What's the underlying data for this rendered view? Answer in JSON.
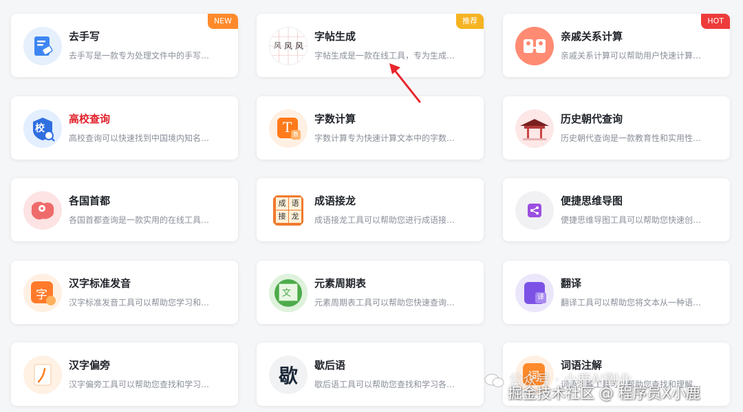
{
  "tools": [
    {
      "title": "去手写",
      "desc": "去手写是一款专为处理文件中的手写…",
      "badge": "NEW",
      "icon": "document-eraser-icon"
    },
    {
      "title": "字帖生成",
      "desc": "字帖生成是一款在线工具，专为生成…",
      "badge": "推荐",
      "icon": "calligraphy-grid-icon",
      "icon_text": [
        "风",
        "风",
        "风"
      ]
    },
    {
      "title": "亲戚关系计算",
      "desc": "亲戚关系计算可以帮助用户快速计算…",
      "badge": "HOT",
      "icon": "family-relation-icon"
    },
    {
      "title": "高校查询",
      "desc": "高校查询可以快速找到中国境内知名…",
      "icon": "school-search-icon",
      "icon_text": "校"
    },
    {
      "title": "字数计算",
      "desc": "字数计算专为快速计算文本中的字数…",
      "icon": "word-count-icon",
      "icon_text": "T",
      "icon_sub": "数"
    },
    {
      "title": "历史朝代查询",
      "desc": "历史朝代查询是一款教育性和实用性…",
      "icon": "ancient-building-icon"
    },
    {
      "title": "各国首都",
      "desc": "各国首都查询是一款实用的在线工具…",
      "icon": "world-map-pin-icon"
    },
    {
      "title": "成语接龙",
      "desc": "成语接龙工具可以帮助您进行成语接…",
      "icon": "idiom-tiles-icon",
      "icon_text": [
        "成",
        "语",
        "接",
        "龙"
      ]
    },
    {
      "title": "便捷思维导图",
      "desc": "便捷思维导图工具可以帮助您快速创…",
      "icon": "mindmap-icon"
    },
    {
      "title": "汉字标准发音",
      "desc": "汉字标准发音工具可以帮助您学习和…",
      "icon": "pronunciation-icon",
      "icon_text": "字"
    },
    {
      "title": "元素周期表",
      "desc": "元素周期表工具可以帮助您快速查询…",
      "icon": "periodic-table-icon",
      "icon_text": "文"
    },
    {
      "title": "翻译",
      "desc": "翻译工具可以帮助您将文本从一种语…",
      "icon": "translate-icon",
      "icon_text": "译"
    },
    {
      "title": "汉字偏旁",
      "desc": "汉字偏旁工具可以帮助您查找和学习…",
      "icon": "radical-stroke-icon"
    },
    {
      "title": "歇后语",
      "desc": "歇后语工具可以帮助您查找和学习各…",
      "icon": "xiehouyu-icon",
      "icon_text": "歇"
    },
    {
      "title": "词语注解",
      "desc": "词语注解工具可以帮助您查找和理解…",
      "icon": "word-annotation-icon",
      "icon_text": "词"
    }
  ],
  "watermark": {
    "line1": "公众号 · 小鹿AI副业",
    "line2": "掘金技术社区 @ 程序员X小鹿"
  },
  "colors": {
    "new": "#ff8a2b",
    "recommend": "#f5b321",
    "hot": "#ee3b3b",
    "highlight_title": "#e0202b",
    "annotation_arrow": "#e8262c"
  }
}
